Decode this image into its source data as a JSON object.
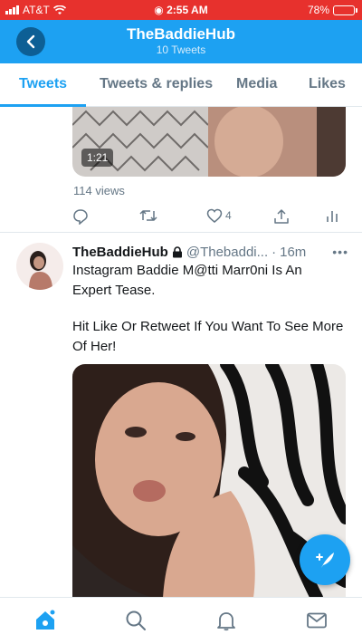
{
  "status_bar": {
    "carrier": "AT&T",
    "time": "2:55 AM",
    "battery": "78%",
    "battery_level": 0.78
  },
  "header": {
    "title": "TheBaddieHub",
    "subtitle": "10 Tweets",
    "back_icon": "chevron-left-icon"
  },
  "tabs": [
    {
      "label": "Tweets",
      "active": true
    },
    {
      "label": "Tweets & replies",
      "active": false
    },
    {
      "label": "Media",
      "active": false
    },
    {
      "label": "Likes",
      "active": false
    }
  ],
  "previous_tweet": {
    "video_duration": "1:21",
    "views": "114 views",
    "actions": {
      "reply_count": "",
      "retweet_count": "",
      "like_count": "4"
    }
  },
  "tweet": {
    "display_name": "TheBaddieHub",
    "protected_icon": "lock-icon",
    "handle": "@Thebaddi...",
    "separator": "·",
    "time": "16m",
    "more_icon": "more-icon",
    "text_line1": "Instagram Baddie M@tti Marr0ni Is An Expert Tease.",
    "text_line2": "Hit Like Or Retweet If You Want To See More Of Her!"
  },
  "fab": {
    "icon": "compose-tweet-icon"
  },
  "bottom_nav": [
    {
      "name": "home",
      "icon": "home-icon",
      "active": true,
      "has_notification_dot": true
    },
    {
      "name": "search",
      "icon": "search-icon",
      "active": false
    },
    {
      "name": "notifications",
      "icon": "bell-icon",
      "active": false
    },
    {
      "name": "messages",
      "icon": "mail-icon",
      "active": false
    }
  ],
  "colors": {
    "brand": "#1da1f2",
    "status_bar": "#e7312d",
    "secondary_text": "#657786"
  }
}
